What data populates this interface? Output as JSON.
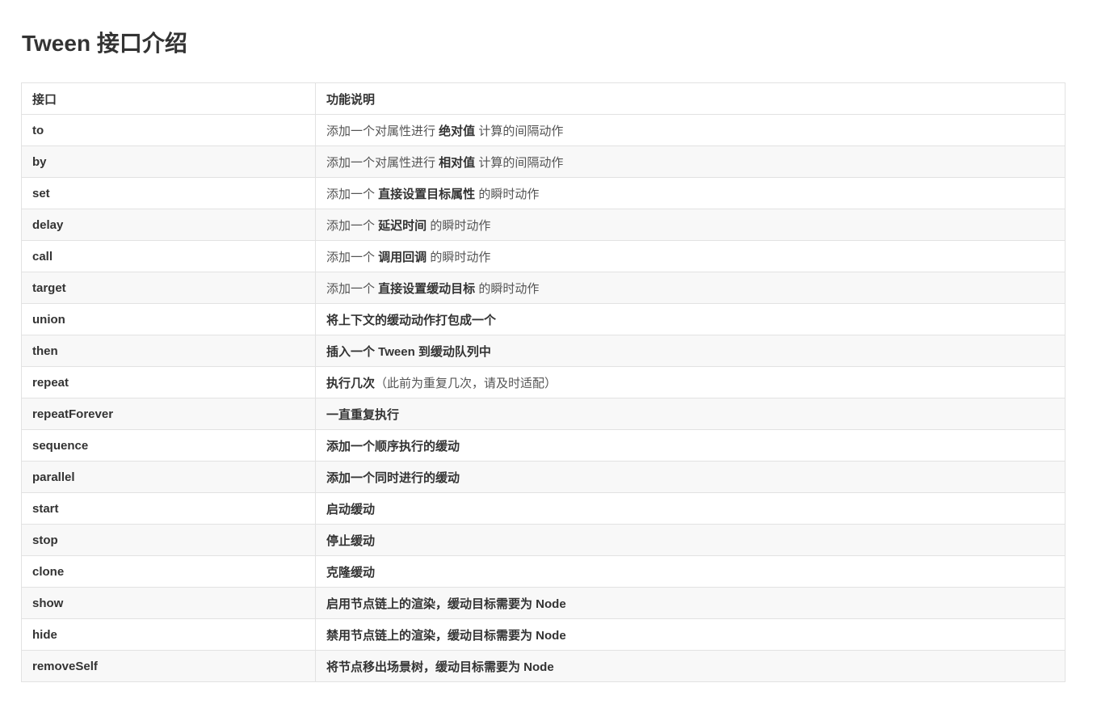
{
  "page": {
    "title": "Tween 接口介绍"
  },
  "table": {
    "headers": [
      "接口",
      "功能说明"
    ],
    "rows": [
      {
        "name": "to",
        "desc": [
          {
            "t": "添加一个对属性进行 ",
            "b": false
          },
          {
            "t": "绝对值",
            "b": true
          },
          {
            "t": " 计算的间隔动作",
            "b": false
          }
        ]
      },
      {
        "name": "by",
        "desc": [
          {
            "t": "添加一个对属性进行 ",
            "b": false
          },
          {
            "t": "相对值",
            "b": true
          },
          {
            "t": " 计算的间隔动作",
            "b": false
          }
        ]
      },
      {
        "name": "set",
        "desc": [
          {
            "t": "添加一个 ",
            "b": false
          },
          {
            "t": "直接设置目标属性",
            "b": true
          },
          {
            "t": " 的瞬时动作",
            "b": false
          }
        ]
      },
      {
        "name": "delay",
        "desc": [
          {
            "t": "添加一个 ",
            "b": false
          },
          {
            "t": "延迟时间",
            "b": true
          },
          {
            "t": " 的瞬时动作",
            "b": false
          }
        ]
      },
      {
        "name": "call",
        "desc": [
          {
            "t": "添加一个 ",
            "b": false
          },
          {
            "t": "调用回调",
            "b": true
          },
          {
            "t": " 的瞬时动作",
            "b": false
          }
        ]
      },
      {
        "name": "target",
        "desc": [
          {
            "t": "添加一个 ",
            "b": false
          },
          {
            "t": "直接设置缓动目标",
            "b": true
          },
          {
            "t": " 的瞬时动作",
            "b": false
          }
        ]
      },
      {
        "name": "union",
        "desc": [
          {
            "t": "将上下文的缓动动作打包成一个",
            "b": true
          }
        ]
      },
      {
        "name": "then",
        "desc": [
          {
            "t": "插入一个 Tween 到缓动队列中",
            "b": true
          }
        ]
      },
      {
        "name": "repeat",
        "desc": [
          {
            "t": "执行几次",
            "b": true
          },
          {
            "t": "（此前为重复几次，请及时适配）",
            "b": false
          }
        ]
      },
      {
        "name": "repeatForever",
        "desc": [
          {
            "t": "一直重复执行",
            "b": true
          }
        ]
      },
      {
        "name": "sequence",
        "desc": [
          {
            "t": "添加一个顺序执行的缓动",
            "b": true
          }
        ]
      },
      {
        "name": "parallel",
        "desc": [
          {
            "t": "添加一个同时进行的缓动",
            "b": true
          }
        ]
      },
      {
        "name": "start",
        "desc": [
          {
            "t": "启动缓动",
            "b": true
          }
        ]
      },
      {
        "name": "stop",
        "desc": [
          {
            "t": "停止缓动",
            "b": true
          }
        ]
      },
      {
        "name": "clone",
        "desc": [
          {
            "t": "克隆缓动",
            "b": true
          }
        ]
      },
      {
        "name": "show",
        "desc": [
          {
            "t": "启用节点链上的渲染，缓动目标需要为 Node",
            "b": true
          }
        ]
      },
      {
        "name": "hide",
        "desc": [
          {
            "t": "禁用节点链上的渲染，缓动目标需要为 Node",
            "b": true
          }
        ]
      },
      {
        "name": "removeSelf",
        "desc": [
          {
            "t": "将节点移出场景树，缓动目标需要为 Node",
            "b": true
          }
        ]
      }
    ]
  }
}
